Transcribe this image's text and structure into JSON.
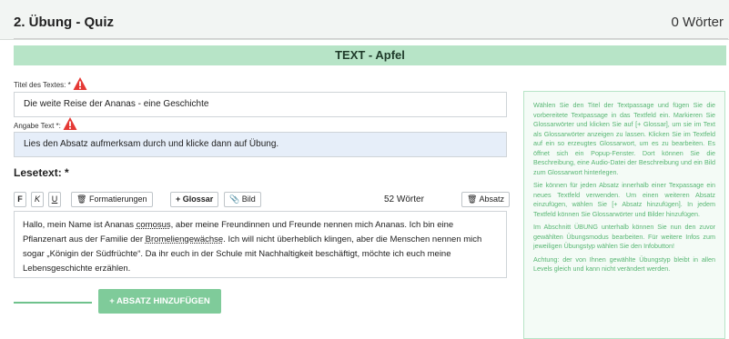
{
  "header": {
    "title": "2. Übung - Quiz",
    "word_count": "0 Wörter"
  },
  "section": {
    "title": "TEXT - Apfel"
  },
  "form": {
    "title_label": "Titel des Textes: *",
    "title_value": "Die weite Reise der Ananas - eine Geschichte",
    "instruction_label": "Angabe Text *:",
    "instruction_value": "Lies den Absatz aufmerksam durch und klicke dann auf Übung.",
    "lesetext_label": "Lesetext: *"
  },
  "toolbar": {
    "bold": "F",
    "italic": "K",
    "underline": "U",
    "formatting": "Formatierungen",
    "glossary": "+ Glossar",
    "image": "Bild",
    "words": "52 Wörter",
    "paragraph": "Absatz"
  },
  "editor": {
    "text_1": "Hallo, mein Name ist Ananas ",
    "glossary_1": "comosus",
    "text_2": ", aber meine Freundinnen und Freunde nennen mich Ananas. Ich bin eine Pflanzenart aus der Familie der ",
    "glossary_2": "Bromeliengewächse",
    "text_3": ". Ich will nicht überheblich klingen, aber die Menschen nennen mich sogar „Königin der Südfrüchte“. Da ihr euch in der Schule mit Nachhaltigkeit beschäftigt, möchte ich euch meine Lebensgeschichte erzählen."
  },
  "add_paragraph_button": "+ ABSATZ HINZUFÜGEN",
  "help": {
    "p1": "Wählen Sie den Titel der Textpassage und fügen Sie die vorbereitete Textpassage in das Textfeld ein. Markieren Sie Glossarwörter und klicken Sie auf [+ Glossar], um sie im Text als Glossarwörter anzeigen zu lassen. Klicken Sie im Textfeld auf ein so erzeugtes Glossarwort, um es zu bearbeiten. Es öffnet sich ein Popup-Fenster. Dort können Sie die Beschreibung, eine Audio-Datei der Beschreibung und ein Bild zum Glossarwort hinterlegen.",
    "p2": "Sie können für jeden Absatz innerhalb einer Texpassage ein neues Textfeld verwenden. Um einen weiteren Absatz einzufügen, wählen Sie [+ Absatz hinzufügen]. In jedem Textfeld können Sie Glossarwörter und Bilder hinzufügen.",
    "p3": "Im Abschnitt ÜBUNG unterhalb können Sie nun den zuvor gewählten Übungsmodus bearbeiten. Für weitere Infos zum jeweiligen Übungstyp wählen Sie den Infobutton!",
    "p4": "Achtung: der von Ihnen gewählte Übungstyp bleibt in allen Levels gleich und kann nicht verändert werden."
  },
  "colors": {
    "accent_green": "#b7e4c7",
    "button_green": "#7fcb9a",
    "help_text": "#57b673",
    "warning_red": "#e53935"
  }
}
